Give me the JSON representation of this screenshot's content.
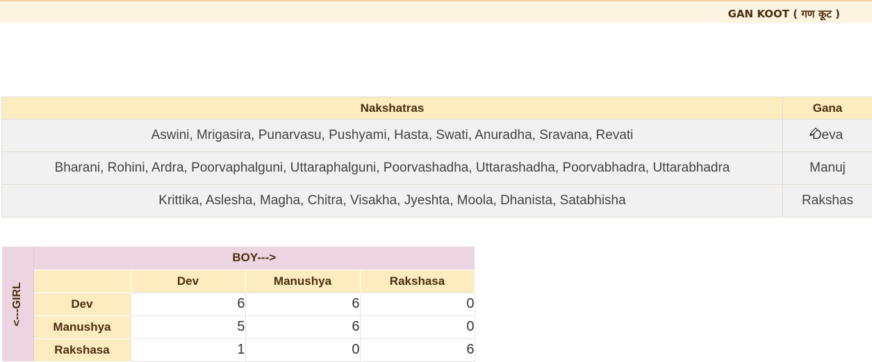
{
  "header": {
    "title": "GAN KOOT ( गण कूट )"
  },
  "nakshatra_table": {
    "columns": [
      "Nakshatras",
      "Gana"
    ],
    "rows": [
      {
        "nakshatras": "Aswini, Mrigasira, Punarvasu, Pushyami, Hasta, Swati, Anuradha, Sravana, Revati",
        "gana": "Deva"
      },
      {
        "nakshatras": "Bharani, Rohini, Ardra, Poorvaphalguni, Uttaraphalguni, Poorvashadha, Uttarashadha, Poorvabhadra, Uttarabhadra",
        "gana": "Manuj"
      },
      {
        "nakshatras": "Krittika, Aslesha, Magha, Chitra, Visakha, Jyeshta, Moola, Dhanista, Satabhisha",
        "gana": "Rakshas"
      }
    ]
  },
  "matrix": {
    "boy_label": "BOY--->",
    "girl_label": "<---GIRL",
    "columns": [
      "Dev",
      "Manushya",
      "Rakshasa"
    ],
    "rows": [
      {
        "label": "Dev",
        "values": [
          "6",
          "6",
          "0"
        ]
      },
      {
        "label": "Manushya",
        "values": [
          "5",
          "6",
          "0"
        ]
      },
      {
        "label": "Rakshasa",
        "values": [
          "1",
          "0",
          "6"
        ]
      }
    ]
  },
  "colors": {
    "header_bg": "#fdecc0",
    "matrix_accent": "#ecd5e0",
    "text_brown": "#4a2e12"
  },
  "icons": {
    "cursor": "pencil-icon"
  }
}
